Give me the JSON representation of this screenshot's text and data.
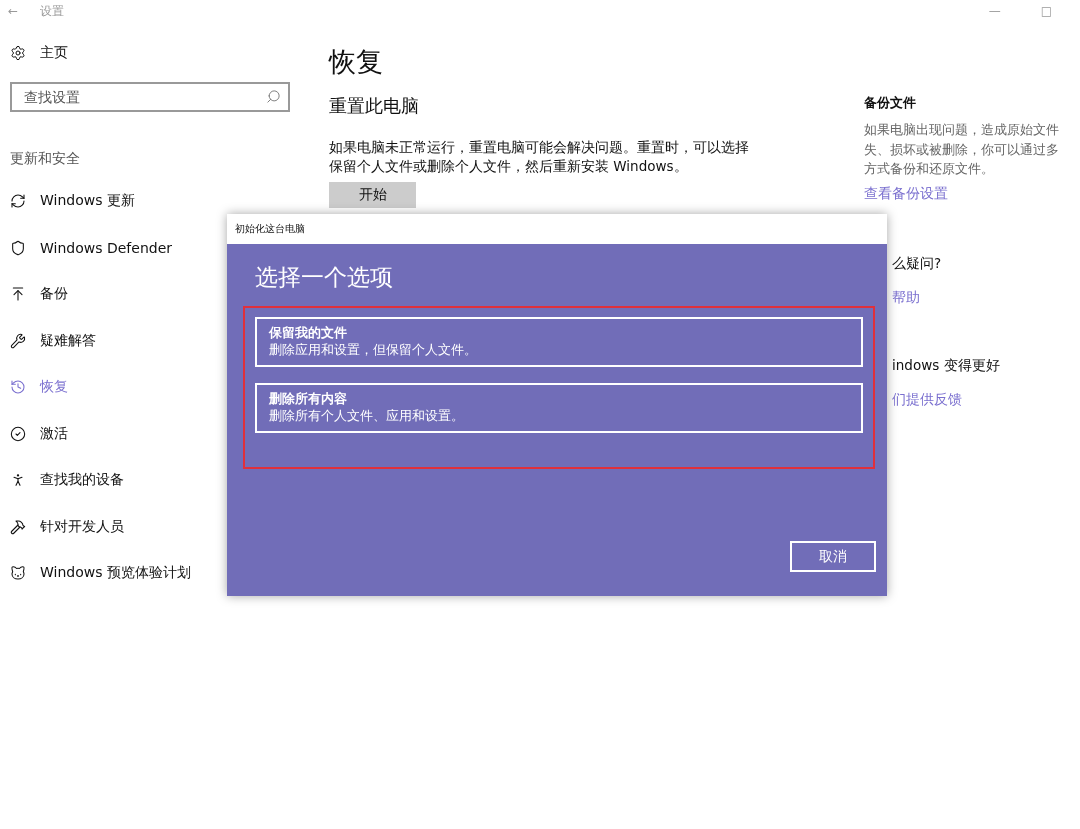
{
  "titlebar": {
    "back": "←",
    "title": "设置",
    "controls": [
      "—",
      "□"
    ]
  },
  "sidebar": {
    "home": "主页",
    "search": {
      "placeholder": "查找设置"
    },
    "section": "更新和安全",
    "items": [
      {
        "label": "Windows 更新",
        "selected": false
      },
      {
        "label": "Windows Defender",
        "selected": false
      },
      {
        "label": "备份",
        "selected": false
      },
      {
        "label": "疑难解答",
        "selected": false
      },
      {
        "label": "恢复",
        "selected": true
      },
      {
        "label": "激活",
        "selected": false
      },
      {
        "label": "查找我的设备",
        "selected": false
      },
      {
        "label": "针对开发人员",
        "selected": false
      },
      {
        "label": "Windows 预览体验计划",
        "selected": false
      }
    ]
  },
  "main": {
    "title": "恢复",
    "section_title": "重置此电脑",
    "description": "如果电脑未正常运行，重置电脑可能会解决问题。重置时，可以选择保留个人文件或删除个人文件，然后重新安装 Windows。",
    "button": "开始"
  },
  "aside": {
    "sections": [
      {
        "title": "备份文件",
        "lines": [
          "如果电脑出现问题，造成原始文件",
          "失、损坏或被删除，你可以通过多",
          "方式备份和还原文件。"
        ],
        "link": "查看备份设置"
      },
      {
        "title": "么疑问?",
        "link": "帮助"
      },
      {
        "title": "indows 变得更好",
        "link": "们提供反馈"
      }
    ]
  },
  "dialog": {
    "title": "初始化这台电脑",
    "heading": "选择一个选项",
    "highlighted": true,
    "options": [
      {
        "title": "保留我的文件",
        "description": "删除应用和设置，但保留个人文件。"
      },
      {
        "title": "删除所有内容",
        "description": "删除所有个人文件、应用和设置。"
      }
    ],
    "cancel": "取消"
  }
}
